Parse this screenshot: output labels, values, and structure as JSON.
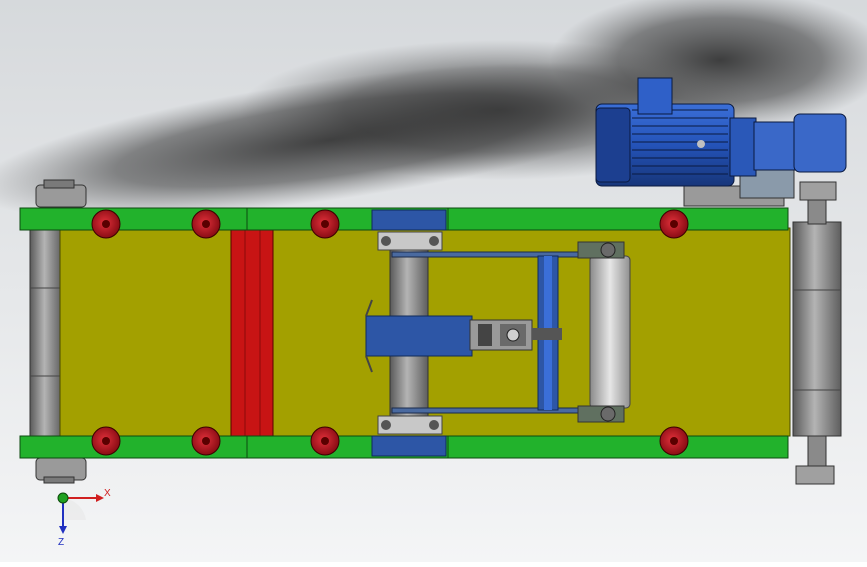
{
  "viewport": {
    "background_top": "#d6d9dc",
    "background_bottom": "#f4f5f6"
  },
  "colors": {
    "frame_green": "#22b22c",
    "belt_yellow": "#a3a000",
    "belt_red": "#c81414",
    "roller_grey": "#8c8c8c",
    "wheel_red": "#b01820",
    "motor_blue": "#2453b8",
    "bracket_blue": "#2d56a6"
  },
  "triad": {
    "x_label": "X",
    "z_label": "Z",
    "x_color": "#d02020",
    "z_color": "#2030c0",
    "origin_color": "#20a020"
  },
  "icons": [
    "coordinate-triad-icon"
  ]
}
